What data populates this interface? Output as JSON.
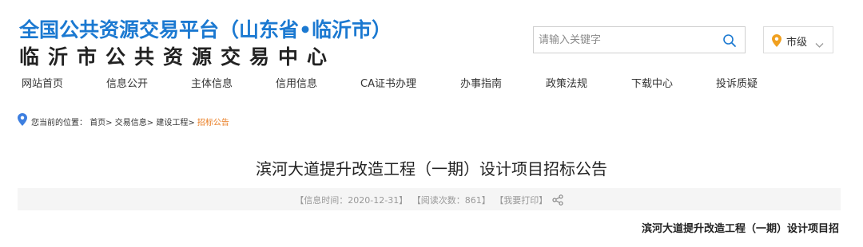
{
  "header": {
    "title_main": "全国公共资源交易平台（山东省•临沂市）",
    "title_sub": "临沂市公共资源交易中心"
  },
  "search": {
    "placeholder": "请输入关键字",
    "icon": "search-icon"
  },
  "city_select": {
    "value": "市级",
    "icon": "location-pin-icon"
  },
  "nav": {
    "items": [
      {
        "label": "网站首页"
      },
      {
        "label": "信息公开"
      },
      {
        "label": "主体信息"
      },
      {
        "label": "信用信息"
      },
      {
        "label": "CA证书办理"
      },
      {
        "label": "办事指南"
      },
      {
        "label": "政策法规"
      },
      {
        "label": "下载中心"
      },
      {
        "label": "投诉质疑"
      }
    ]
  },
  "breadcrumb": {
    "prefix": "您当前的位置：",
    "items": [
      "首页>",
      "交易信息>",
      "建设工程>",
      "招标公告"
    ]
  },
  "article": {
    "title": "滨河大道提升改造工程（一期）设计项目招标公告",
    "meta": {
      "time": "【信息时间：2020-12-31】",
      "views": "【阅读次数：861】",
      "print": "【我要打印】"
    },
    "doc_heading": "滨河大道提升改造工程（一期）设计项目招"
  },
  "colors": {
    "brand_blue": "#1b79d1",
    "highlight_orange": "#e97b1f",
    "pin_blue": "#3d7fe0",
    "pin_orange": "#f0a020"
  }
}
